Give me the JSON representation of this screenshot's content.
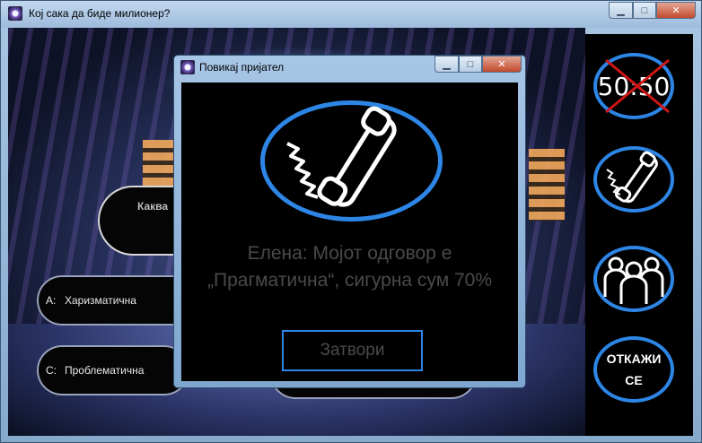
{
  "main_window": {
    "title": "Кој сака да биде милионер?"
  },
  "game": {
    "question_partial": "Каква",
    "answers": [
      {
        "letter": "A:",
        "text": "Харизматична"
      },
      {
        "letter": "C:",
        "text": "Проблематична"
      }
    ]
  },
  "lifelines": {
    "fifty_fifty": {
      "text": "50:50",
      "used": true
    },
    "phone_friend": {
      "icon": "phone-icon"
    },
    "ask_audience": {
      "icon": "audience-icon"
    },
    "cancel": {
      "line1": "ОТКАЖИ",
      "line2": "СЕ"
    }
  },
  "dialog": {
    "title": "Повикај пријател",
    "message": "Елена: Мојот одговор е\n„Прагматична“, сигурна сум 70%",
    "close_label": "Затвори"
  },
  "colors": {
    "accent_blue": "#2d86e6",
    "dim_text": "#4a4a4a"
  }
}
